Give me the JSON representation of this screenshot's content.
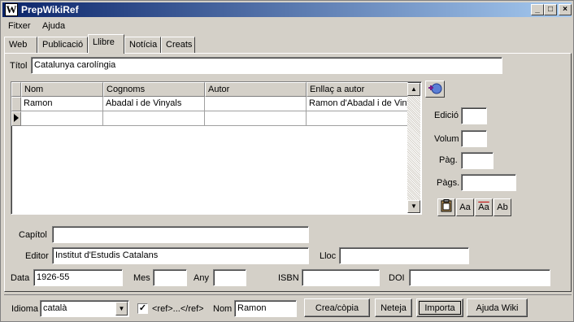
{
  "window": {
    "title": "PrepWikiRef",
    "logo_text": "W",
    "controls": {
      "minimize_icon": "minimize-icon",
      "maximize_icon": "maximize-icon",
      "close_icon": "close-icon"
    }
  },
  "menu": [
    {
      "label": "Fitxer"
    },
    {
      "label": "Ajuda"
    }
  ],
  "tabs": [
    {
      "label": "Web",
      "active": false
    },
    {
      "label": "Publicació",
      "active": false
    },
    {
      "label": "Llibre",
      "active": true
    },
    {
      "label": "Notícia",
      "active": false
    },
    {
      "label": "Creats",
      "active": false
    }
  ],
  "form": {
    "titol": {
      "label": "Títol",
      "value": "Catalunya carolíngia"
    },
    "authors_table": {
      "columns": [
        "Nom",
        "Cognoms",
        "Autor",
        "Enllaç a autor"
      ],
      "rows": [
        {
          "nom": "Ramon",
          "cognoms": "Abadal i de Vinyals",
          "autor": "",
          "enllac": "Ramon d'Abadal i de Viny"
        },
        {
          "nom": "",
          "cognoms": "",
          "autor": "",
          "enllac": ""
        }
      ]
    },
    "edicio": {
      "label": "Edició",
      "value": ""
    },
    "volum": {
      "label": "Volum",
      "value": ""
    },
    "pag": {
      "label": "Pàg.",
      "value": ""
    },
    "pags": {
      "label": "Pàgs.",
      "value": ""
    },
    "text_buttons": [
      {
        "icon": "clipboard-icon",
        "text": ""
      },
      {
        "icon": "font-grow-icon",
        "text": "Aa"
      },
      {
        "icon": "font-cycle-icon",
        "text": "Aa"
      },
      {
        "icon": "font-small-icon",
        "text": "Ab"
      }
    ],
    "capitol": {
      "label": "Capítol",
      "value": ""
    },
    "editor": {
      "label": "Editor",
      "value": "Institut d'Estudis Catalans"
    },
    "lloc": {
      "label": "Lloc",
      "value": ""
    },
    "data": {
      "label": "Data",
      "value": "1926-55"
    },
    "mes": {
      "label": "Mes",
      "value": ""
    },
    "any": {
      "label": "Any",
      "value": ""
    },
    "isbn": {
      "label": "ISBN",
      "value": ""
    },
    "doi": {
      "label": "DOI",
      "value": ""
    }
  },
  "bottom": {
    "idioma": {
      "label": "Idioma",
      "value": "català"
    },
    "ref_checkbox": {
      "checked": true,
      "label": "<ref>...</ref>"
    },
    "nom": {
      "label": "Nom",
      "value": "Ramon"
    },
    "buttons": {
      "crea": "Crea/còpia",
      "neteja": "Neteja",
      "importa": "Importa",
      "ajuda": "Ajuda Wiki"
    }
  }
}
